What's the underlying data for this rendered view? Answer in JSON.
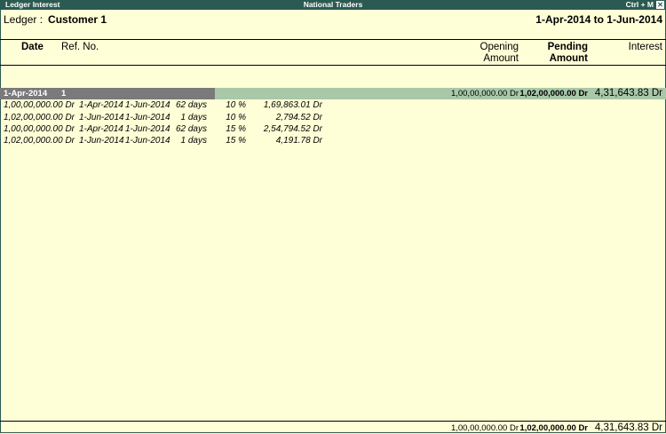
{
  "window": {
    "title": "Ledger Interest",
    "company": "National Traders",
    "shortcut": "Ctrl + M",
    "close_glyph": "✕"
  },
  "header": {
    "ledger_label": "Ledger :",
    "ledger_value": "Customer 1",
    "period": "1-Apr-2014 to 1-Jun-2014"
  },
  "columns": {
    "date": "Date",
    "ref_no": "Ref. No.",
    "opening_line1": "Opening",
    "opening_line2": "Amount",
    "pending_line1": "Pending",
    "pending_line2": "Amount",
    "interest": "Interest"
  },
  "group": {
    "date": "1-Apr-2014",
    "ref": "1",
    "opening": "1,00,00,000.00 Dr",
    "pending": "1,02,00,000.00 Dr",
    "interest": "4,31,643.83 Dr"
  },
  "details": [
    {
      "amount": "1,00,00,000.00 Dr",
      "from": "1-Apr-2014",
      "to": "1-Jun-2014",
      "days": "62 days",
      "rate": "10 %",
      "interest": "1,69,863.01 Dr"
    },
    {
      "amount": "1,02,00,000.00 Dr",
      "from": "1-Jun-2014",
      "to": "1-Jun-2014",
      "days": "1 days",
      "rate": "10 %",
      "interest": "2,794.52 Dr"
    },
    {
      "amount": "1,00,00,000.00 Dr",
      "from": "1-Apr-2014",
      "to": "1-Jun-2014",
      "days": "62 days",
      "rate": "15 %",
      "interest": "2,54,794.52 Dr"
    },
    {
      "amount": "1,02,00,000.00 Dr",
      "from": "1-Jun-2014",
      "to": "1-Jun-2014",
      "days": "1 days",
      "rate": "15 %",
      "interest": "4,191.78 Dr"
    }
  ],
  "totals": {
    "opening": "1,00,00,000.00 Dr",
    "pending": "1,02,00,000.00 Dr",
    "interest": "4,31,643.83 Dr"
  },
  "colors": {
    "titlebar": "#2b5a52",
    "background": "#fefed7",
    "group_left": "#7a7a7a",
    "group_right": "#a8c8a8"
  }
}
